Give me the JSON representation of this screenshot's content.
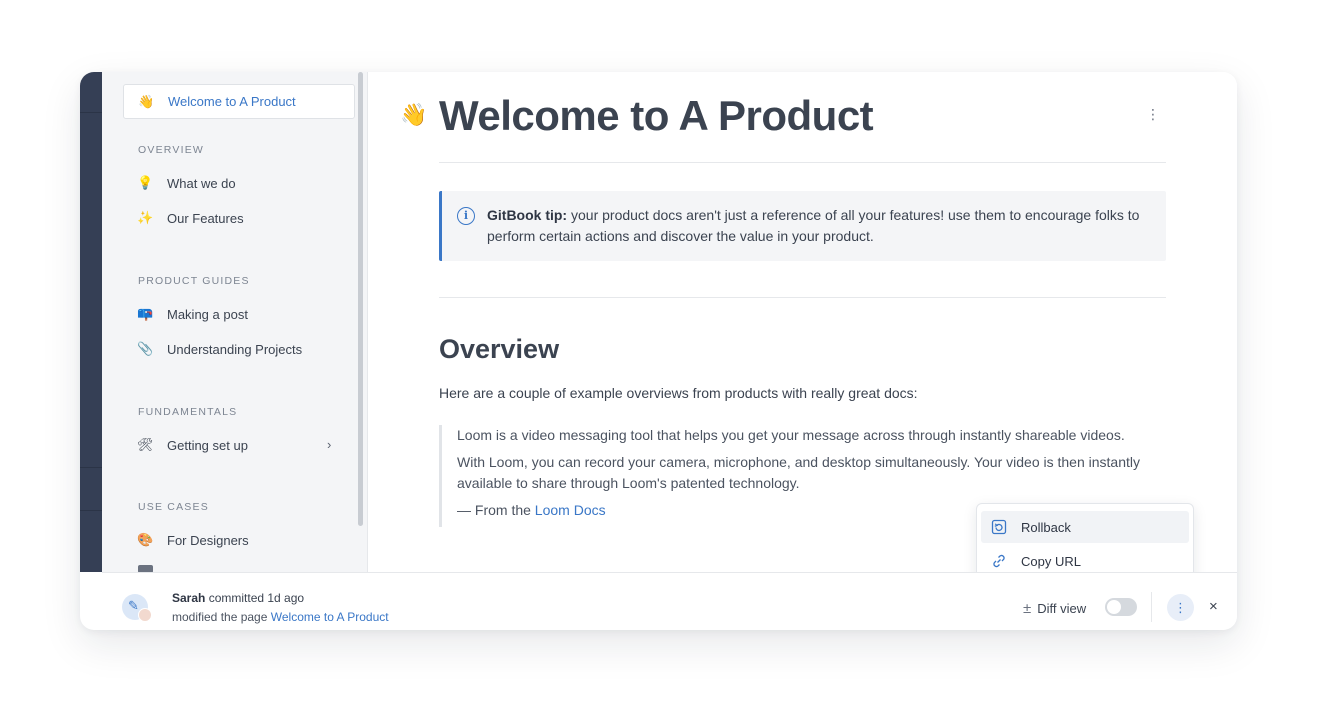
{
  "sidebar": {
    "active": {
      "emoji": "👋",
      "label": "Welcome to A Product"
    },
    "sections": [
      {
        "title": "OVERVIEW",
        "items": [
          {
            "emoji": "💡",
            "label": "What we do"
          },
          {
            "emoji": "✨",
            "label": "Our Features"
          }
        ]
      },
      {
        "title": "PRODUCT GUIDES",
        "items": [
          {
            "emoji": "📪",
            "label": "Making a post"
          },
          {
            "emoji": "📎",
            "label": "Understanding Projects"
          }
        ]
      },
      {
        "title": "FUNDAMENTALS",
        "items": [
          {
            "emoji": "🛠",
            "label": "Getting set up",
            "chevron": "›"
          }
        ]
      },
      {
        "title": "USE CASES",
        "items": [
          {
            "emoji": "🎨",
            "label": "For Designers"
          }
        ]
      }
    ]
  },
  "page": {
    "emoji": "👋",
    "title": "Welcome to A Product",
    "kebab": "⋮",
    "hint": {
      "icon": "i",
      "bold": "GitBook tip:",
      "text": " your product docs aren't just a reference of all your features! use them to encourage folks to perform certain actions and discover the value in your product."
    },
    "section_heading": "Overview",
    "intro": "Here are a couple of example overviews from products with really great docs:",
    "quote": {
      "p1": "Loom is a video messaging tool that helps you get your message across through instantly shareable videos.",
      "p2": "With Loom, you can record your camera, microphone, and desktop simultaneously. Your video is then instantly available to share through Loom's patented technology.",
      "cite_prefix": "— From the ",
      "cite_link": "Loom Docs"
    }
  },
  "menu": {
    "items": [
      {
        "label": "Rollback",
        "icon": "rollback-icon"
      },
      {
        "label": "Copy URL",
        "icon": "link-icon"
      }
    ]
  },
  "footer": {
    "author": "Sarah",
    "action": " committed 1d ago",
    "line2_prefix": "modified the page ",
    "line2_link": "Welcome to A Product",
    "diff_icon": "±",
    "diff_label": "Diff view",
    "diff_enabled": false,
    "more": "⋮",
    "close": "×"
  },
  "colors": {
    "accent": "#3a77c7",
    "rail": "#353f55",
    "sidebar_bg": "#f4f5f7",
    "text": "#3b4350"
  }
}
